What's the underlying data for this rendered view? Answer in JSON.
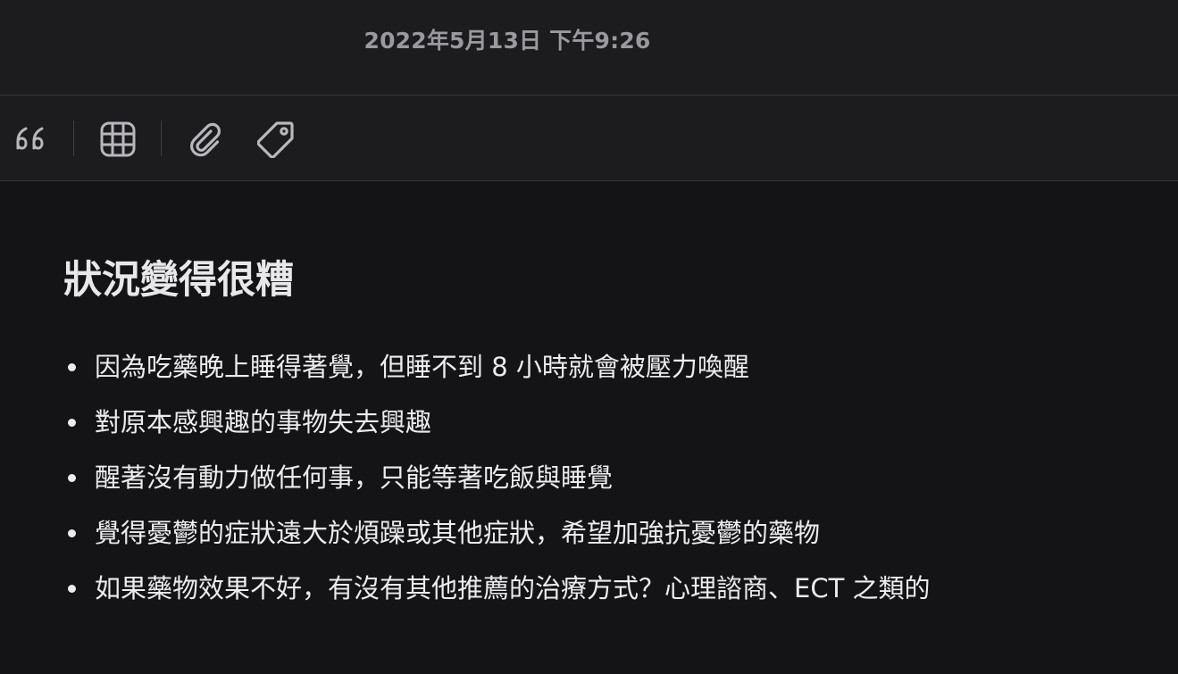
{
  "header": {
    "timestamp": "2022年5月13日 下午9:26"
  },
  "toolbar": {
    "items": [
      {
        "icon": "quote-icon"
      },
      {
        "icon": "table-grid-icon"
      },
      {
        "icon": "paperclip-icon"
      },
      {
        "icon": "tag-icon"
      }
    ]
  },
  "note": {
    "title": "狀況變得很糟",
    "bullets": [
      "因為吃藥晚上睡得著覺，但睡不到 8 小時就會被壓力喚醒",
      "對原本感興趣的事物失去興趣",
      "醒著沒有動力做任何事，只能等著吃飯與睡覺",
      "覺得憂鬱的症狀遠大於煩躁或其他症狀，希望加強抗憂鬱的藥物",
      "如果藥物效果不好，有沒有其他推薦的治療方式？心理諮商、ECT 之類的"
    ]
  },
  "colors": {
    "background": "#141416",
    "panel": "#1c1c1e",
    "text": "#ececee",
    "muted": "#9a9a9e",
    "icon": "#b8b8bc"
  }
}
